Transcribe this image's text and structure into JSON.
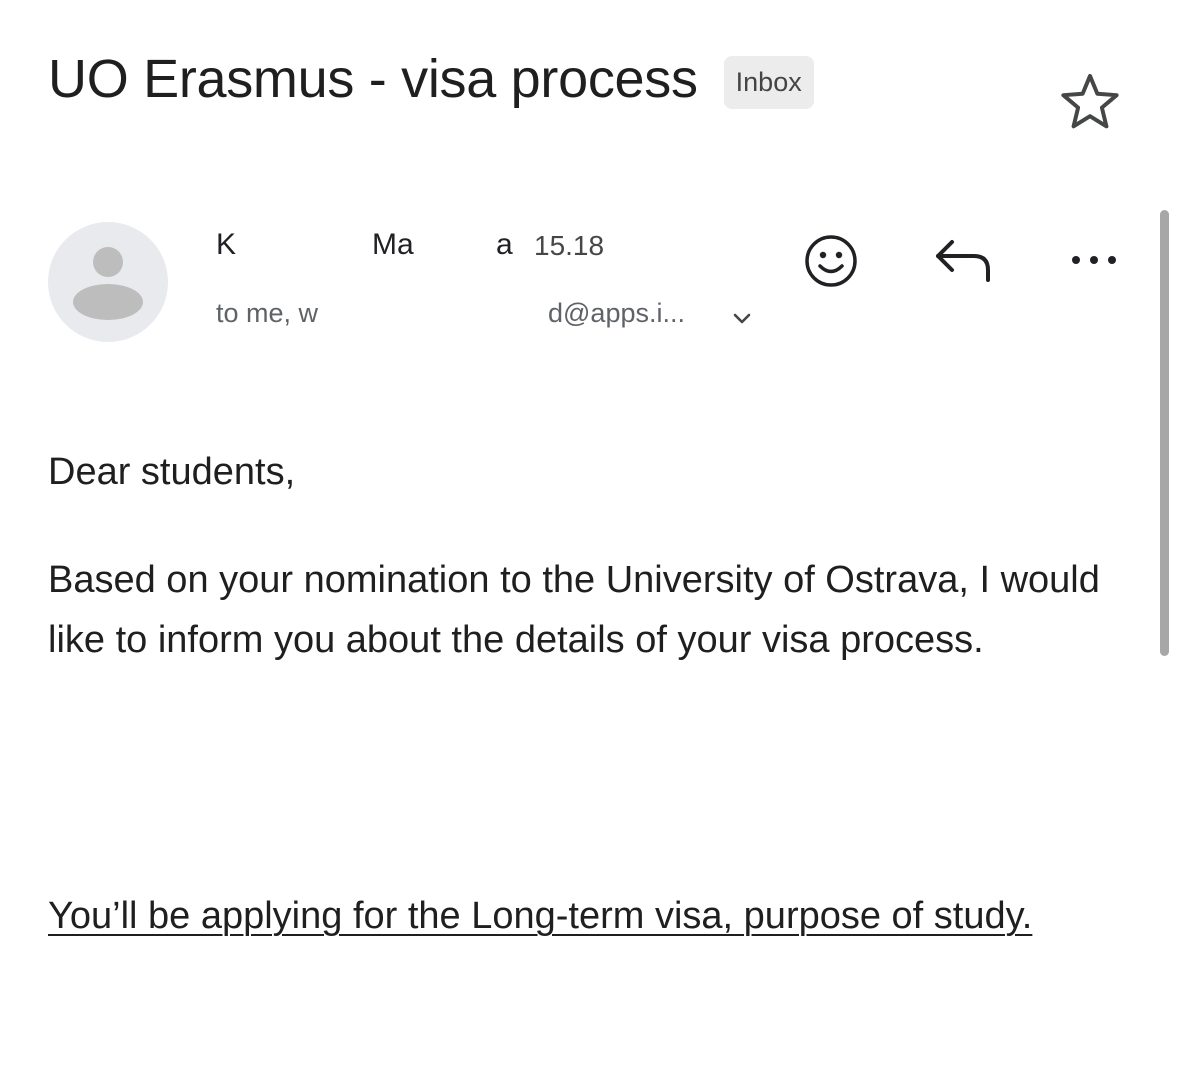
{
  "email": {
    "subject": "UO Erasmus - visa process",
    "label_chip": "Inbox",
    "sender": {
      "name_visible": "K",
      "name_fragment_1": "Ma",
      "name_fragment_2": "a",
      "time": "15.18",
      "recipients_prefix": "to me, w",
      "recipients_suffix": "d@apps.i..."
    },
    "body": {
      "greeting": "Dear students,",
      "paragraph_1": "Based on your nomination to the University of Ostrava, I would like to inform you about the details of your visa process.",
      "link_paragraph": "You’ll be applying for the Long-term visa, purpose of study."
    }
  },
  "icons": {
    "star": "star-outline-icon",
    "avatar": "default-avatar-icon",
    "emoji": "add-emoji-reaction-icon",
    "reply": "reply-icon",
    "more": "more-options-icon",
    "chevron": "chevron-down-icon"
  },
  "colors": {
    "text_primary": "#1f1f1f",
    "text_secondary": "#5f6368",
    "chip_background": "#ececec",
    "avatar_background": "#e8eaed",
    "avatar_figure": "#bdbdbd",
    "icon": "#444746"
  }
}
